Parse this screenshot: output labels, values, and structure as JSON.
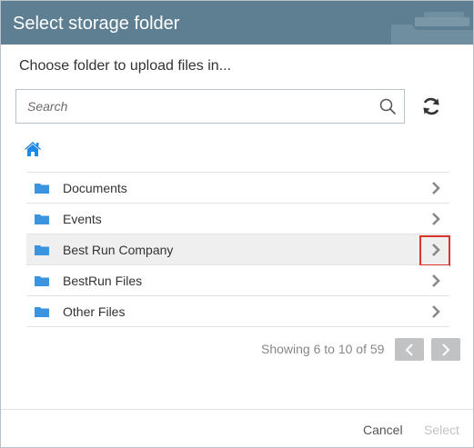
{
  "dialog": {
    "title": "Select storage folder",
    "subtitle": "Choose folder to upload files in..."
  },
  "search": {
    "placeholder": "Search",
    "value": ""
  },
  "icons": {
    "search": "magnifier-icon",
    "refresh": "refresh-icon",
    "home": "home-icon",
    "folder": "folder-icon",
    "chevron": "chevron-right-icon",
    "page_prev": "chevron-left-icon",
    "page_next": "chevron-right-icon"
  },
  "folders": [
    {
      "label": "Documents",
      "selected": false,
      "highlighted": false
    },
    {
      "label": "Events",
      "selected": false,
      "highlighted": false
    },
    {
      "label": "Best Run Company",
      "selected": true,
      "highlighted": true
    },
    {
      "label": "BestRun Files",
      "selected": false,
      "highlighted": false
    },
    {
      "label": "Other Files",
      "selected": false,
      "highlighted": false
    }
  ],
  "paging": {
    "text": "Showing 6 to 10 of 59"
  },
  "footer": {
    "cancel_label": "Cancel",
    "select_label": "Select"
  },
  "colors": {
    "header": "#5e7f92",
    "folder_icon": "#3b94e0",
    "home_icon": "#1e88e5",
    "highlight": "#d9342f",
    "selected_row": "#efefef",
    "page_button": "#c0c2c4"
  }
}
